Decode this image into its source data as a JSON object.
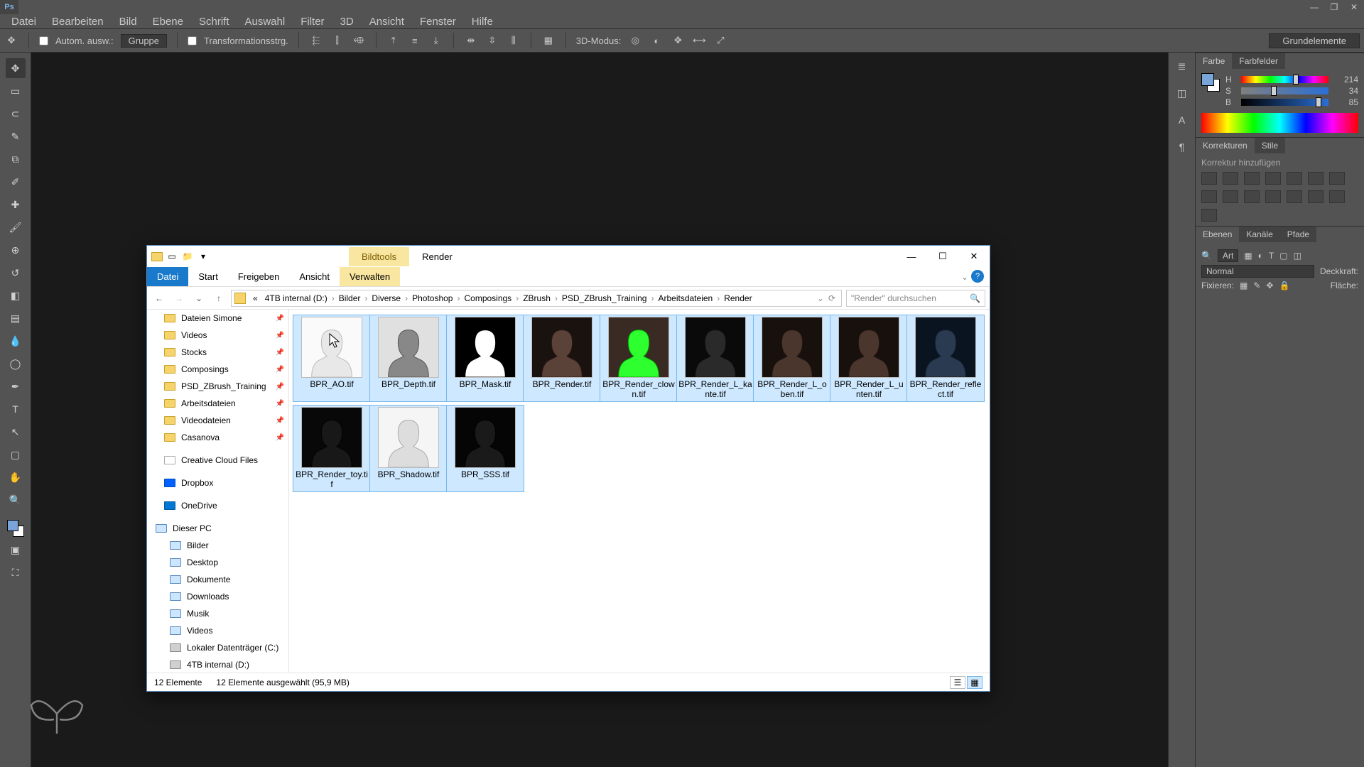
{
  "ps": {
    "menus": [
      "Datei",
      "Bearbeiten",
      "Bild",
      "Ebene",
      "Schrift",
      "Auswahl",
      "Filter",
      "3D",
      "Ansicht",
      "Fenster",
      "Hilfe"
    ],
    "options": {
      "auto": "Autom. ausw.:",
      "group": "Gruppe",
      "trans": "Transformationsstrg.",
      "mode3d": "3D-Modus:",
      "preset": "Grundelemente"
    },
    "color": {
      "tab1": "Farbe",
      "tab2": "Farbfelder",
      "h_label": "H",
      "s_label": "S",
      "b_label": "B",
      "h": "214",
      "s": "34",
      "b": "85"
    },
    "corr": {
      "tab1": "Korrekturen",
      "tab2": "Stile",
      "hint": "Korrektur hinzufügen"
    },
    "layers": {
      "tab1": "Ebenen",
      "tab2": "Kanäle",
      "tab3": "Pfade",
      "kind": "Art",
      "mode": "Normal",
      "opacity": "Deckkraft:",
      "lock": "Fixieren:",
      "fill": "Fläche:"
    }
  },
  "explorer": {
    "title_tab1": "Bildtools",
    "title_tab2": "Render",
    "ribbon": [
      "Datei",
      "Start",
      "Freigeben",
      "Ansicht",
      "Verwalten"
    ],
    "breadcrumb_prefix": "«",
    "breadcrumbs": [
      "4TB internal (D:)",
      "Bilder",
      "Diverse",
      "Photoshop",
      "Composings",
      "ZBrush",
      "PSD_ZBrush_Training",
      "Arbeitsdateien",
      "Render"
    ],
    "search_placeholder": "\"Render\" durchsuchen",
    "nav_quick": [
      "Dateien Simone",
      "Videos",
      "Stocks",
      "Composings",
      "PSD_ZBrush_Training",
      "Arbeitsdateien",
      "Videodateien",
      "Casanova"
    ],
    "nav_ccf": "Creative Cloud Files",
    "nav_dropbox": "Dropbox",
    "nav_onedrive": "OneDrive",
    "nav_thispc": "Dieser PC",
    "nav_pc_items": [
      "Bilder",
      "Desktop",
      "Dokumente",
      "Downloads",
      "Musik",
      "Videos",
      "Lokaler Datenträger (C:)",
      "4TB internal (D:)"
    ],
    "files": [
      {
        "name": "BPR_AO.tif",
        "v": "ao"
      },
      {
        "name": "BPR_Depth.tif",
        "v": "depth"
      },
      {
        "name": "BPR_Mask.tif",
        "v": "mask"
      },
      {
        "name": "BPR_Render.tif",
        "v": "render"
      },
      {
        "name": "BPR_Render_clown.tif",
        "v": "clown"
      },
      {
        "name": "BPR_Render_L_kante.tif",
        "v": "dark"
      },
      {
        "name": "BPR_Render_L_oben.tif",
        "v": "render2"
      },
      {
        "name": "BPR_Render_L_unten.tif",
        "v": "render2"
      },
      {
        "name": "BPR_Render_reflect.tif",
        "v": "reflect"
      },
      {
        "name": "BPR_Render_toy.tif",
        "v": "toy"
      },
      {
        "name": "BPR_Shadow.tif",
        "v": "shadow"
      },
      {
        "name": "BPR_SSS.tif",
        "v": "sss"
      }
    ],
    "status_count": "12 Elemente",
    "status_sel": "12 Elemente ausgewählt (95,9 MB)"
  }
}
